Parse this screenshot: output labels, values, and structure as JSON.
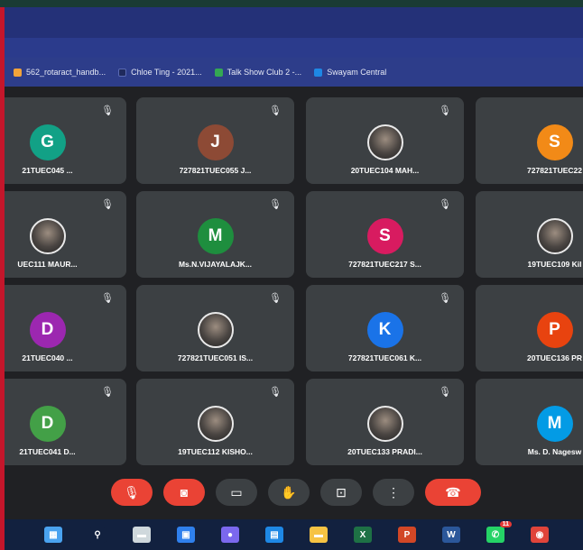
{
  "bookmarks": [
    {
      "label": "562_rotaract_handb...",
      "icon": "document-icon",
      "color": "#f2a33a"
    },
    {
      "label": "Chloe Ting - 2021...",
      "icon": "youtube-icon",
      "color": "#1f2a5c"
    },
    {
      "label": "Talk Show Club 2 -...",
      "icon": "google-drive-icon",
      "color": "#34a853"
    },
    {
      "label": "Swayam Central",
      "icon": "swayam-icon",
      "color": "#1e88e5"
    }
  ],
  "participants": [
    {
      "name": "21TUEC045 ...",
      "initial": "G",
      "color": "#12a186",
      "photo": false
    },
    {
      "name": "727821TUEC055 J...",
      "initial": "J",
      "color": "#8d4a35",
      "photo": false
    },
    {
      "name": "20TUEC104 MAH...",
      "initial": "",
      "color": "",
      "photo": true
    },
    {
      "name": "727821TUEC22",
      "initial": "S",
      "color": "#f28a17",
      "photo": false
    },
    {
      "name": "UEC111 MAUR...",
      "initial": "",
      "color": "",
      "photo": true
    },
    {
      "name": "Ms.N.VIJAYALAJK...",
      "initial": "M",
      "color": "#1e8e3e",
      "photo": false
    },
    {
      "name": "727821TUEC217 S...",
      "initial": "S",
      "color": "#d81b60",
      "photo": false
    },
    {
      "name": "19TUEC109 Kil",
      "initial": "",
      "color": "",
      "photo": true
    },
    {
      "name": "21TUEC040 ...",
      "initial": "D",
      "color": "#9c27b0",
      "photo": false
    },
    {
      "name": "727821TUEC051 IS...",
      "initial": "",
      "color": "",
      "photo": true
    },
    {
      "name": "727821TUEC061 K...",
      "initial": "K",
      "color": "#1a73e8",
      "photo": false
    },
    {
      "name": "20TUEC136 PR",
      "initial": "P",
      "color": "#e8430f",
      "photo": false
    },
    {
      "name": "21TUEC041 D...",
      "initial": "D",
      "color": "#43a047",
      "photo": false
    },
    {
      "name": "19TUEC112 KISHO...",
      "initial": "",
      "color": "",
      "photo": true
    },
    {
      "name": "20TUEC133 PRADI...",
      "initial": "",
      "color": "",
      "photo": true
    },
    {
      "name": "Ms. D. Nagesw",
      "initial": "M",
      "color": "#039be5",
      "photo": false
    }
  ],
  "mute_glyph": "🎙",
  "controls": [
    {
      "name": "microphone-off-button",
      "icon": "mic-off-icon",
      "glyph": "🎙",
      "style": "red"
    },
    {
      "name": "camera-off-button",
      "icon": "camera-off-icon",
      "glyph": "◙",
      "style": "red"
    },
    {
      "name": "captions-button",
      "icon": "captions-icon",
      "glyph": "▭",
      "style": "gray"
    },
    {
      "name": "raise-hand-button",
      "icon": "hand-icon",
      "glyph": "✋",
      "style": "gray"
    },
    {
      "name": "present-screen-button",
      "icon": "present-icon",
      "glyph": "⊡",
      "style": "gray"
    },
    {
      "name": "more-options-button",
      "icon": "more-vertical-icon",
      "glyph": "⋮",
      "style": "gray"
    },
    {
      "name": "leave-call-button",
      "icon": "phone-hangup-icon",
      "glyph": "☎",
      "style": "red"
    }
  ],
  "taskbar": [
    {
      "name": "windows-start",
      "icon": "windows-icon",
      "color": "#4aa3f0",
      "glyph": "▦"
    },
    {
      "name": "search",
      "icon": "search-icon",
      "color": "#12213f",
      "glyph": "⚲"
    },
    {
      "name": "task-view",
      "icon": "task-view-icon",
      "color": "#cfd8dc",
      "glyph": "▬"
    },
    {
      "name": "widgets",
      "icon": "widgets-icon",
      "color": "#2f80ed",
      "glyph": "▣"
    },
    {
      "name": "chat",
      "icon": "chat-icon",
      "color": "#7b68ee",
      "glyph": "●"
    },
    {
      "name": "store",
      "icon": "store-icon",
      "color": "#1e88e5",
      "glyph": "▤"
    },
    {
      "name": "file-explorer",
      "icon": "folder-icon",
      "color": "#f6c343",
      "glyph": "▬"
    },
    {
      "name": "excel",
      "icon": "excel-icon",
      "color": "#1e7145",
      "glyph": "X"
    },
    {
      "name": "powerpoint",
      "icon": "powerpoint-icon",
      "color": "#d24726",
      "glyph": "P"
    },
    {
      "name": "word",
      "icon": "word-icon",
      "color": "#2b579a",
      "glyph": "W"
    },
    {
      "name": "whatsapp",
      "icon": "whatsapp-icon",
      "color": "#25d366",
      "glyph": "✆",
      "badge": "11"
    },
    {
      "name": "chrome",
      "icon": "chrome-icon",
      "color": "#e0443a",
      "glyph": "◉"
    }
  ]
}
